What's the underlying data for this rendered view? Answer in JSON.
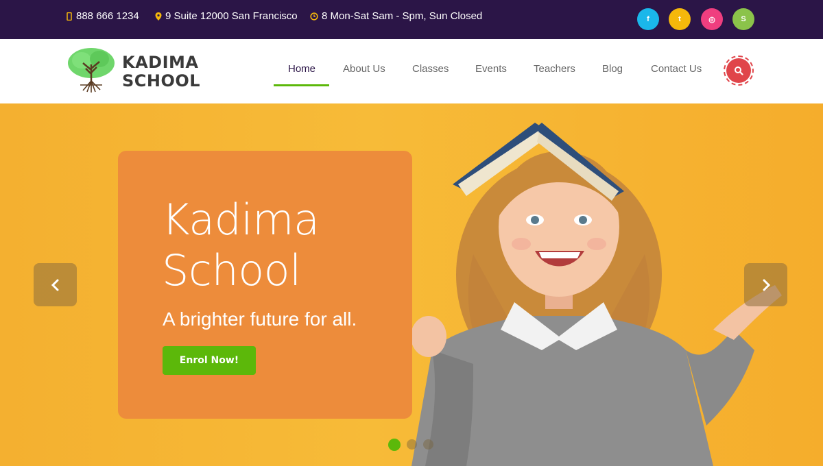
{
  "topbar": {
    "phone": "888 666 1234",
    "address": "9 Suite 12000 San Francisco",
    "hours": "8 Mon-Sat Sam - Spm, Sun Closed",
    "social": [
      {
        "icon": "facebook-icon",
        "glyph": "f",
        "color": "#1ab7ea"
      },
      {
        "icon": "twitter-icon",
        "glyph": "t",
        "color": "#f5b80b"
      },
      {
        "icon": "instagram-icon",
        "glyph": "◎",
        "color": "#ef3e7f"
      },
      {
        "icon": "skype-icon",
        "glyph": "S",
        "color": "#8bc34a"
      }
    ]
  },
  "header": {
    "logo_line1": "KADIMA",
    "logo_line2": "SCHOOL",
    "nav": [
      "Home",
      "About Us",
      "Classes",
      "Events",
      "Teachers",
      "Blog",
      "Contact Us"
    ],
    "active_nav": "Home"
  },
  "hero": {
    "title_line1": "Kadima",
    "title_line2": "School",
    "subtitle": "A brighter future for all.",
    "cta": "Enrol Now!",
    "slide_count": 3,
    "active_slide": 1
  },
  "colors": {
    "topbar": "#2b1547",
    "accent_green": "#5cb80a",
    "card_orange": "#ed8c3b",
    "hero_yellow": "#f7bb38",
    "search_red": "#e0454a"
  }
}
